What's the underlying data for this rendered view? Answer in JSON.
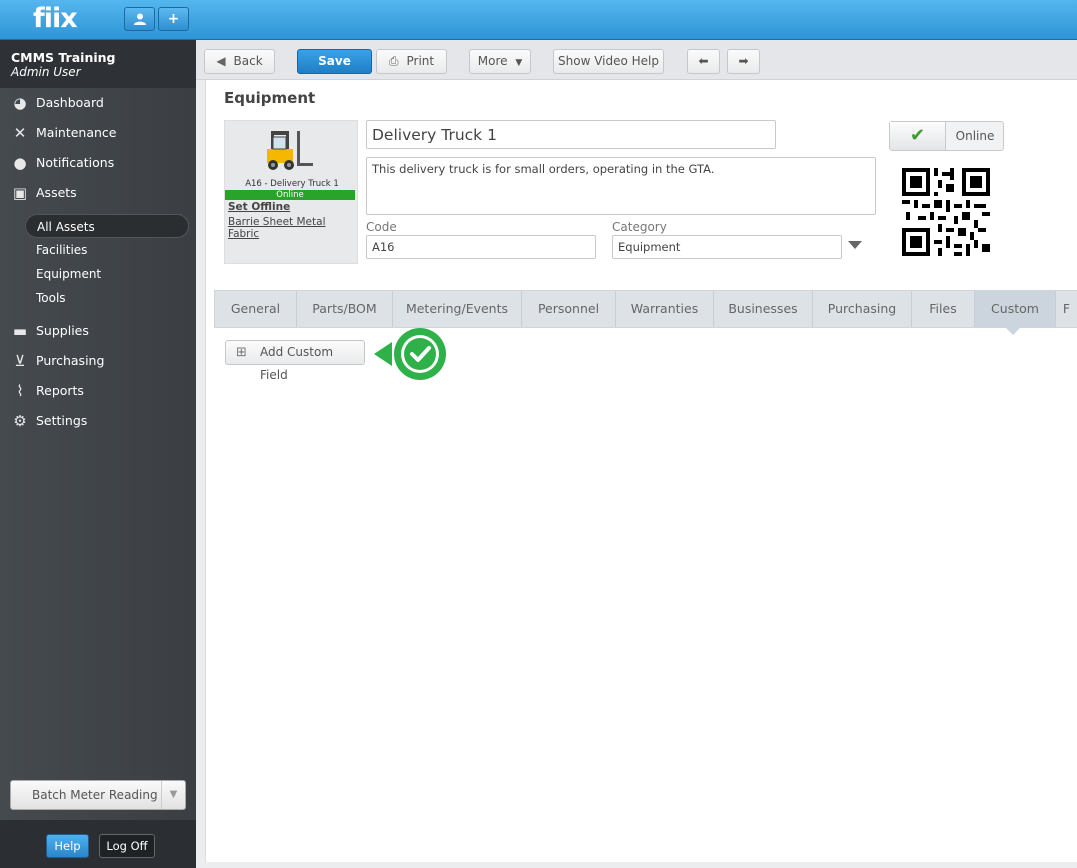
{
  "app": {
    "logo": "fiix",
    "topbar_user_icon": "user-icon",
    "topbar_add_label": "+"
  },
  "sidebar": {
    "org_name": "CMMS Training",
    "user_role": "Admin User",
    "nav": [
      {
        "label": "Dashboard",
        "icon": "dashboard-icon"
      },
      {
        "label": "Maintenance",
        "icon": "tools-icon"
      },
      {
        "label": "Notifications",
        "icon": "chat-bubble-icon"
      },
      {
        "label": "Assets",
        "icon": "boxes-icon"
      },
      {
        "label": "Supplies",
        "icon": "truck-icon"
      },
      {
        "label": "Purchasing",
        "icon": "cart-icon"
      },
      {
        "label": "Reports",
        "icon": "chart-icon"
      },
      {
        "label": "Settings",
        "icon": "gear-icon"
      }
    ],
    "assets_sub": [
      "All Assets",
      "Facilities",
      "Equipment",
      "Tools"
    ],
    "batch_label": "Batch Meter Reading",
    "help_label": "Help",
    "logoff_label": "Log Off"
  },
  "toolbar": {
    "back": "Back",
    "save": "Save",
    "print": "Print",
    "more": "More",
    "video_help": "Show Video Help"
  },
  "page": {
    "title": "Equipment",
    "asset_caption": "A16 - Delivery Truck 1",
    "asset_status": "Online",
    "set_offline": "Set Offline",
    "business": "Barrie Sheet Metal Fabric",
    "name": "Delivery Truck 1",
    "description": "This delivery truck is for small orders, operating in the GTA.",
    "code_label": "Code",
    "code_value": "A16",
    "category_label": "Category",
    "category_value": "Equipment",
    "online_label": "Online"
  },
  "tabs": [
    "General",
    "Parts/BOM",
    "Metering/Events",
    "Personnel",
    "Warranties",
    "Businesses",
    "Purchasing",
    "Files",
    "Custom",
    "F"
  ],
  "active_tab": "Custom",
  "custom": {
    "add_field": "Add Custom Field"
  },
  "colors": {
    "accent": "#2e95d6",
    "online": "#29a329",
    "callout": "#2fb14a"
  }
}
